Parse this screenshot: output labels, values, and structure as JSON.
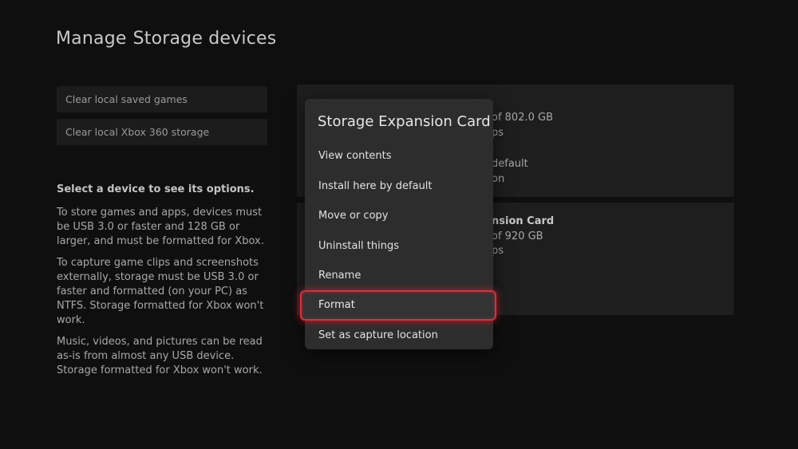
{
  "header": {
    "title": "Manage",
    "subtitle": "Storage devices"
  },
  "left_panel": {
    "buttons": [
      {
        "label": "Clear local saved games"
      },
      {
        "label": "Clear local Xbox 360 storage"
      }
    ],
    "info_heading": "Select a device to see its options.",
    "info_paragraphs": [
      "To store games and apps, devices must be USB 3.0 or faster and 128 GB or larger, and must be formatted for Xbox.",
      "To capture game clips and screenshots externally, storage must be USB 3.0 or faster and formatted (on your PC) as NTFS. Storage formatted for Xbox won't work.",
      "Music, videos, and pictures can be read as-is from almost any USB device. Storage formatted for Xbox won't work."
    ]
  },
  "devices": [
    {
      "visible_lines": [
        "of 802.0 GB",
        "ps",
        "default",
        "on"
      ]
    },
    {
      "visible_lines": [
        "nsion Card",
        "of 920 GB",
        "ps"
      ]
    }
  ],
  "context_menu": {
    "title": "Storage Expansion Card",
    "items": [
      {
        "label": "View contents"
      },
      {
        "label": "Install here by default"
      },
      {
        "label": "Move or copy"
      },
      {
        "label": "Uninstall things"
      },
      {
        "label": "Rename"
      },
      {
        "label": "Format"
      },
      {
        "label": "Set as capture location"
      }
    ],
    "focused_index": 5
  },
  "colors": {
    "background": "#0f0f0f",
    "panel": "#1e1e1e",
    "menu": "#2d2d2d",
    "focus_outline": "#e02b3a"
  }
}
